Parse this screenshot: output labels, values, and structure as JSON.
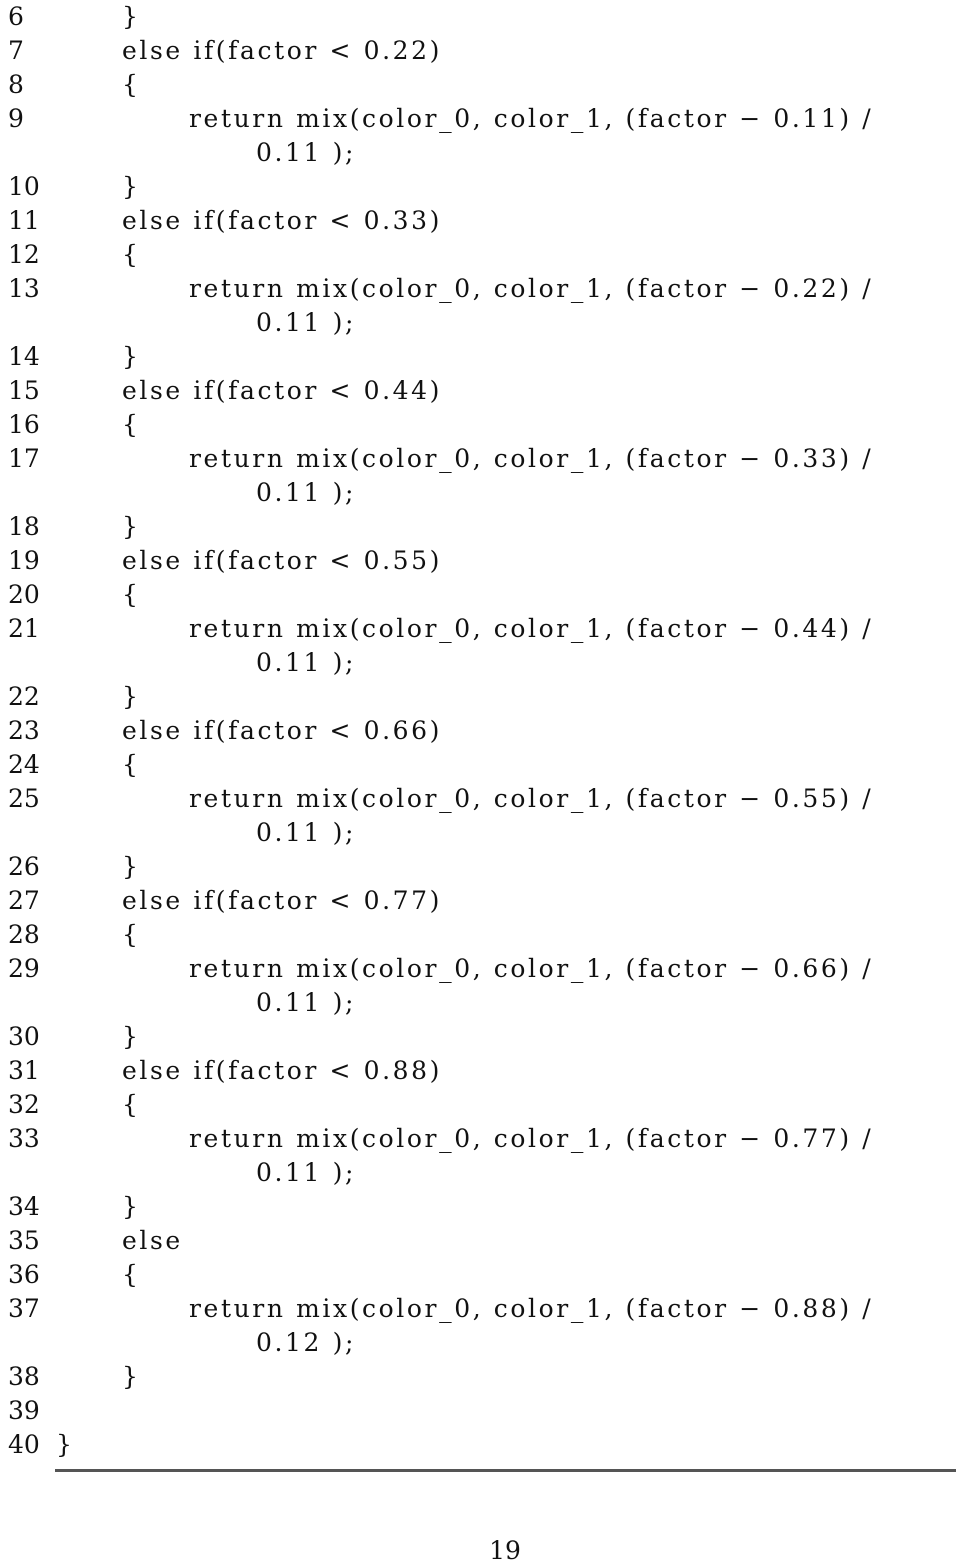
{
  "code_lines": [
    {
      "num": "6",
      "text": "}"
    },
    {
      "num": "7",
      "text": "else if(factor < 0.22)"
    },
    {
      "num": "8",
      "text": "{"
    },
    {
      "num": "9",
      "text": "return mix(color_0, color_1, (factor − 0.11) /"
    },
    {
      "num": "",
      "text": "0.11 );"
    },
    {
      "num": "10",
      "text": "}"
    },
    {
      "num": "11",
      "text": "else if(factor < 0.33)"
    },
    {
      "num": "12",
      "text": "{"
    },
    {
      "num": "13",
      "text": "return mix(color_0, color_1, (factor − 0.22) /"
    },
    {
      "num": "",
      "text": "0.11 );"
    },
    {
      "num": "14",
      "text": "}"
    },
    {
      "num": "15",
      "text": "else if(factor < 0.44)"
    },
    {
      "num": "16",
      "text": "{"
    },
    {
      "num": "17",
      "text": "return mix(color_0, color_1, (factor − 0.33) /"
    },
    {
      "num": "",
      "text": "0.11 );"
    },
    {
      "num": "18",
      "text": "}"
    },
    {
      "num": "19",
      "text": "else if(factor < 0.55)"
    },
    {
      "num": "20",
      "text": "{"
    },
    {
      "num": "21",
      "text": "return mix(color_0, color_1, (factor − 0.44) /"
    },
    {
      "num": "",
      "text": "0.11 );"
    },
    {
      "num": "22",
      "text": "}"
    },
    {
      "num": "23",
      "text": "else if(factor < 0.66)"
    },
    {
      "num": "24",
      "text": "{"
    },
    {
      "num": "25",
      "text": "return mix(color_0, color_1, (factor − 0.55) /"
    },
    {
      "num": "",
      "text": "0.11 );"
    },
    {
      "num": "26",
      "text": "}"
    },
    {
      "num": "27",
      "text": "else if(factor < 0.77)"
    },
    {
      "num": "28",
      "text": "{"
    },
    {
      "num": "29",
      "text": "return mix(color_0, color_1, (factor − 0.66) /"
    },
    {
      "num": "",
      "text": "0.11 );"
    },
    {
      "num": "30",
      "text": "}"
    },
    {
      "num": "31",
      "text": "else if(factor < 0.88)"
    },
    {
      "num": "32",
      "text": "{"
    },
    {
      "num": "33",
      "text": "return mix(color_0, color_1, (factor − 0.77) /"
    },
    {
      "num": "",
      "text": "0.11 );"
    },
    {
      "num": "34",
      "text": "}"
    },
    {
      "num": "35",
      "text": "else"
    },
    {
      "num": "36",
      "text": "{"
    },
    {
      "num": "37",
      "text": "return mix(color_0, color_1, (factor − 0.88) /"
    },
    {
      "num": "",
      "text": "0.12 );"
    },
    {
      "num": "38",
      "text": "}"
    },
    {
      "num": "39",
      "text": ""
    },
    {
      "num": "40",
      "text": "}"
    }
  ],
  "page_number": "19"
}
